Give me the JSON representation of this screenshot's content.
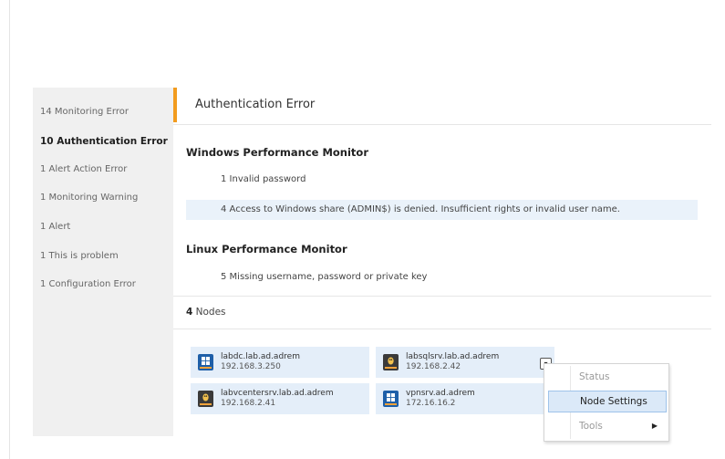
{
  "sidebar": {
    "items": [
      {
        "label": "14 Monitoring Error"
      },
      {
        "label": "10 Authentication Error"
      },
      {
        "label": "1 Alert Action Error"
      },
      {
        "label": "1 Monitoring Warning"
      },
      {
        "label": "1 Alert"
      },
      {
        "label": "1 This is problem"
      },
      {
        "label": "1 Configuration Error"
      }
    ]
  },
  "main": {
    "title": "Authentication Error",
    "groups": [
      {
        "title": "Windows Performance Monitor",
        "errors": [
          {
            "text": "1  Invalid password"
          },
          {
            "text": "4  Access to Windows share (ADMIN$) is denied. Insufficient rights or invalid user name."
          }
        ]
      },
      {
        "title": "Linux Performance Monitor",
        "errors": [
          {
            "text": "5  Missing username, password or private key"
          }
        ]
      }
    ],
    "nodes_count": "4",
    "nodes_label": "Nodes",
    "nodes": [
      {
        "name": "labdc.lab.ad.adrem",
        "ip": "192.168.3.250",
        "os_icon": "windows-server-icon"
      },
      {
        "name": "labsqlsrv.lab.ad.adrem",
        "ip": "192.168.2.42",
        "os_icon": "linux-server-icon"
      },
      {
        "name": "labvcentersrv.lab.ad.adrem",
        "ip": "192.168.2.41",
        "os_icon": "linux-server-icon"
      },
      {
        "name": "vpnsrv.ad.adrem",
        "ip": "172.16.16.2",
        "os_icon": "windows-server-icon"
      }
    ]
  },
  "context_menu": {
    "items": [
      {
        "label": "Status",
        "state": "disabled"
      },
      {
        "label": "Node Settings",
        "state": "selected"
      },
      {
        "label": "Tools",
        "state": "disabled",
        "submenu": true
      }
    ]
  },
  "colors": {
    "accent": "#f29c1f",
    "sidebar_bg": "#f0f0f0",
    "highlight_row": "#eaf2fa",
    "node_tile": "#e4eef9",
    "menu_selected": "#dbe9f8"
  }
}
